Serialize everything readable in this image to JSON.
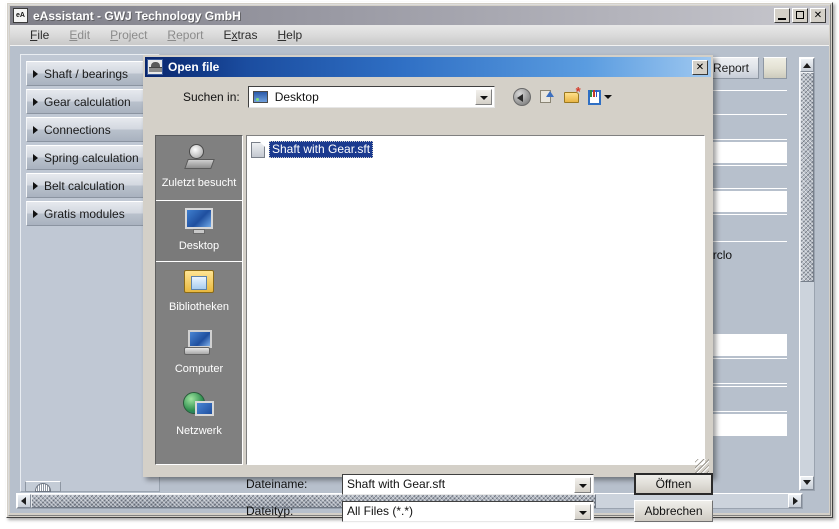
{
  "app": {
    "title": "eAssistant - GWJ Technology GmbH",
    "icon": "eA",
    "window_controls": {
      "minimize": "minimize-icon",
      "maximize": "maximize-icon",
      "close": "✕"
    },
    "menu": [
      {
        "label": "File",
        "mnemonic": "F",
        "enabled": true
      },
      {
        "label": "Edit",
        "mnemonic": "E",
        "enabled": false
      },
      {
        "label": "Project",
        "mnemonic": "P",
        "enabled": false
      },
      {
        "label": "Report",
        "mnemonic": "R",
        "enabled": false
      },
      {
        "label": "Extras",
        "mnemonic": "x",
        "enabled": true
      },
      {
        "label": "Help",
        "mnemonic": "H",
        "enabled": true
      }
    ],
    "modules": [
      {
        "label": "Shaft / bearings"
      },
      {
        "label": "Gear calculation"
      },
      {
        "label": "Connections"
      },
      {
        "label": "Spring calculation"
      },
      {
        "label": "Belt calculation"
      },
      {
        "label": "Gratis modules"
      }
    ],
    "content": {
      "report_button": "Report",
      "radio_option": "Counterclo"
    }
  },
  "dialog": {
    "title": "Open file",
    "icon": "java-coffee-icon",
    "close_label": "✕",
    "lookin": {
      "label": "Suchen in:",
      "value": "Desktop",
      "icon": "desktop-monitor-icon"
    },
    "toolbar": [
      {
        "name": "back-icon"
      },
      {
        "name": "up-one-level-icon"
      },
      {
        "name": "new-folder-icon"
      },
      {
        "name": "view-menu-icon"
      }
    ],
    "places": [
      {
        "label": "Zuletzt besucht",
        "icon": "recent-items-icon",
        "selected": false
      },
      {
        "label": "Desktop",
        "icon": "desktop-icon",
        "selected": true
      },
      {
        "label": "Bibliotheken",
        "icon": "libraries-icon",
        "selected": false
      },
      {
        "label": "Computer",
        "icon": "computer-icon",
        "selected": false
      },
      {
        "label": "Netzwerk",
        "icon": "network-icon",
        "selected": false
      }
    ],
    "files": [
      {
        "name": "Shaft with Gear.sft",
        "selected": true,
        "icon": "file-icon"
      }
    ],
    "filename": {
      "label": "Dateiname:",
      "value": "Shaft with Gear.sft"
    },
    "filetype": {
      "label": "Dateityp:",
      "value": "All Files (*.*)"
    },
    "buttons": {
      "open": "Öffnen",
      "cancel": "Abbrechen"
    }
  },
  "colors": {
    "dialog_title_start": "#08246b",
    "dialog_title_end": "#9fc8f0",
    "app_face": "#d4d0c8",
    "client_bg": "#b7c0cc",
    "places_bg": "#808080",
    "selection_blue": "#1b3a8f"
  }
}
